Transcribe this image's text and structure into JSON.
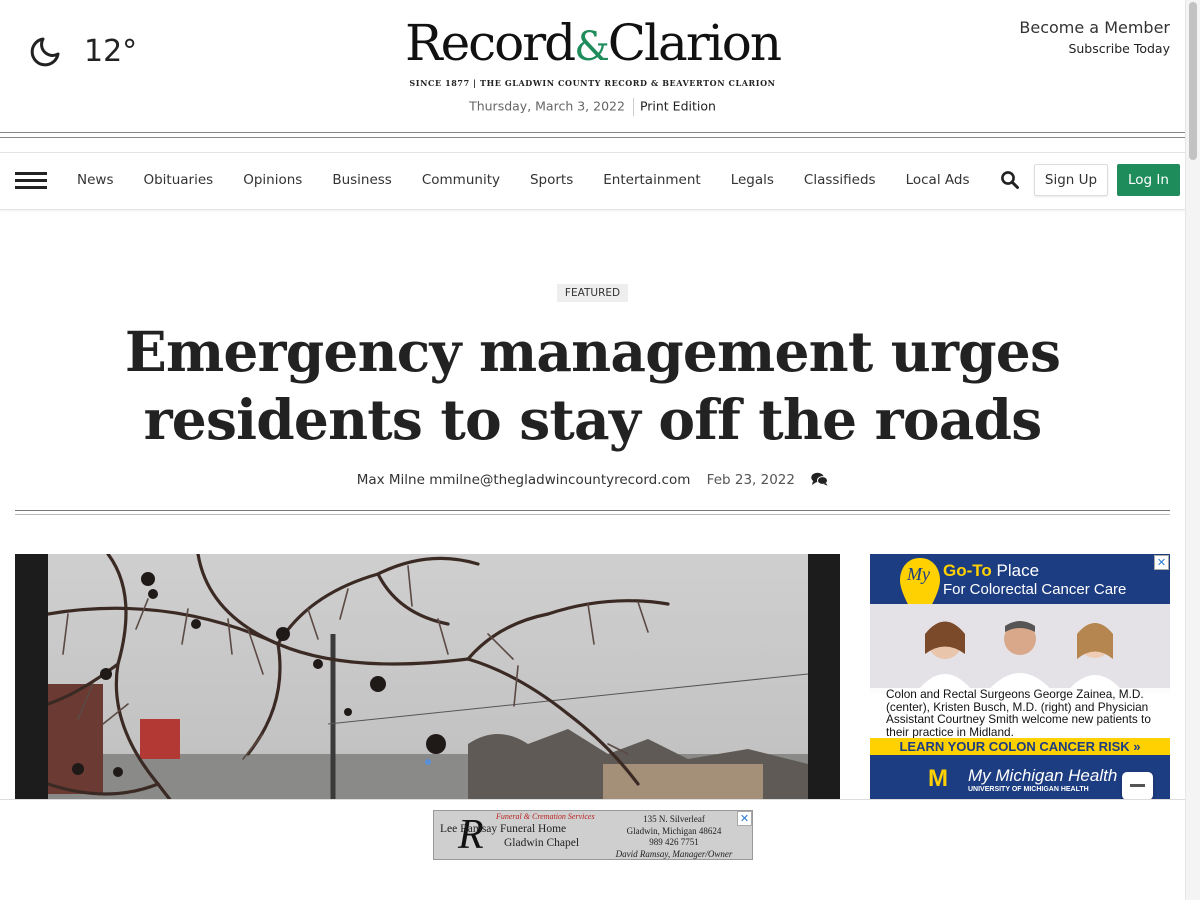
{
  "weather": {
    "icon": "moon-icon",
    "temperature": "12°"
  },
  "masthead": {
    "name_part1": "Record",
    "name_amp": "&",
    "name_part2": "Clarion",
    "tagline": "SINCE 1877  |  THE GLADWIN COUNTY RECORD & BEAVERTON CLARION",
    "date": "Thursday, March 3, 2022",
    "print_edition": "Print Edition"
  },
  "membership": {
    "become_member": "Become a Member",
    "subscribe": "Subscribe Today"
  },
  "nav": {
    "items": [
      "News",
      "Obituaries",
      "Opinions",
      "Business",
      "Community",
      "Sports",
      "Entertainment",
      "Legals",
      "Classifieds",
      "Local Ads"
    ],
    "signup_label": "Sign Up",
    "login_label": "Log In",
    "accent_color": "#1e8c5b"
  },
  "article": {
    "tag": "FEATURED",
    "headline_line1": "Emergency management urges",
    "headline_line2": "residents to stay off the roads",
    "author": "Max Milne",
    "email": "mmilne@thegladwincountyrecord.com",
    "published": "Feb 23, 2022",
    "comments_icon": "comments-icon"
  },
  "side_ad": {
    "my": "My",
    "goto_bold": "Go-To",
    "goto_rest": " Place",
    "subhead": "For Colorectal Cancer Care",
    "body": "Colon and Rectal Surgeons George Zainea, M.D. (center), Kristen Busch, M.D. (right) and Physician Assistant Courtney Smith welcome new patients to their practice in Midland.",
    "cta": "LEARN YOUR COLON CANCER RISK »",
    "brand": "My Michigan Health",
    "brand_sub": "UNIVERSITY OF MICHIGAN HEALTH",
    "logo_letter": "M"
  },
  "bottom_ad": {
    "line_top": "Funeral & Cremation Services",
    "name_line1": "Lee Ramsay Funeral Home",
    "name_line2": "Gladwin Chapel",
    "initial": "R",
    "address1": "135 N. Silverleaf",
    "address2": "Gladwin, Michigan 48624",
    "phone": "989 426 7751",
    "owner": "David Ramsay, Manager/Owner"
  }
}
